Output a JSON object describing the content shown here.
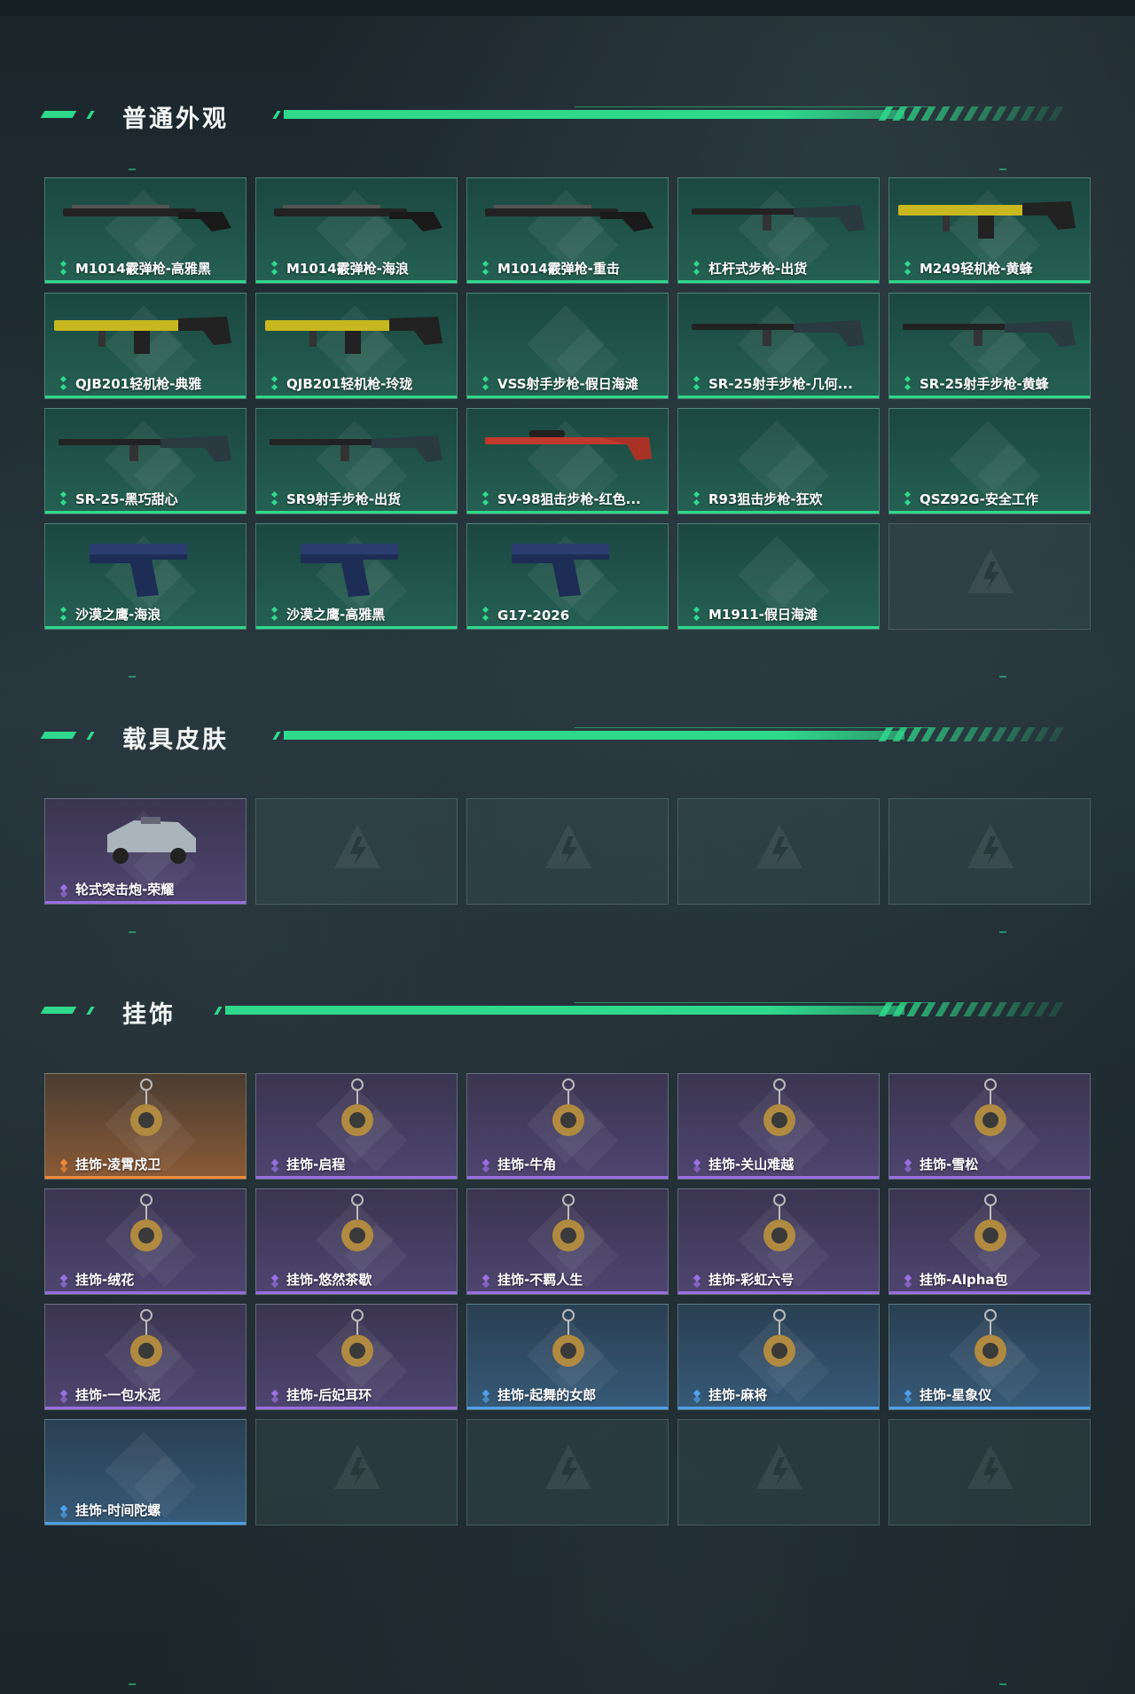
{
  "sections": [
    {
      "title": "普通外观",
      "items": [
        {
          "label": "M1014霰弹枪-高雅黑",
          "rarity": "green",
          "icon": "shotgun-icon"
        },
        {
          "label": "M1014霰弹枪-海浪",
          "rarity": "green",
          "icon": "shotgun-icon"
        },
        {
          "label": "M1014霰弹枪-重击",
          "rarity": "green",
          "icon": "shotgun-icon"
        },
        {
          "label": "杠杆式步枪-出货",
          "rarity": "green",
          "icon": "rifle-icon"
        },
        {
          "label": "M249轻机枪-黄蜂",
          "rarity": "green",
          "icon": "machine-gun-icon"
        },
        {
          "label": "QJB201轻机枪-典雅",
          "rarity": "green",
          "icon": "machine-gun-icon"
        },
        {
          "label": "QJB201轻机枪-玲珑",
          "rarity": "green",
          "icon": "machine-gun-icon"
        },
        {
          "label": "VSS射手步枪-假日海滩",
          "rarity": "green",
          "icon": ""
        },
        {
          "label": "SR-25射手步枪-几何...",
          "rarity": "green",
          "icon": "rifle-icon"
        },
        {
          "label": "SR-25射手步枪-黄蜂",
          "rarity": "green",
          "icon": "rifle-icon"
        },
        {
          "label": "SR-25-黑巧甜心",
          "rarity": "green",
          "icon": "rifle-icon"
        },
        {
          "label": "SR9射手步枪-出货",
          "rarity": "green",
          "icon": "rifle-icon"
        },
        {
          "label": "SV-98狙击步枪-红色...",
          "rarity": "green",
          "icon": "sniper-icon"
        },
        {
          "label": "R93狙击步枪-狂欢",
          "rarity": "green",
          "icon": ""
        },
        {
          "label": "QSZ92G-安全工作",
          "rarity": "green",
          "icon": ""
        },
        {
          "label": "沙漠之鹰-海浪",
          "rarity": "green",
          "icon": "pistol-icon"
        },
        {
          "label": "沙漠之鹰-高雅黑",
          "rarity": "green",
          "icon": "pistol-icon"
        },
        {
          "label": "G17-2026",
          "rarity": "green",
          "icon": "pistol-icon"
        },
        {
          "label": "M1911-假日海滩",
          "rarity": "green",
          "icon": ""
        },
        {
          "label": "",
          "rarity": "empty",
          "icon": "logo-icon"
        }
      ]
    },
    {
      "title": "载具皮肤",
      "items": [
        {
          "label": "轮式突击炮-荣耀",
          "rarity": "purple",
          "icon": "vehicle-icon"
        },
        {
          "label": "",
          "rarity": "empty",
          "icon": "logo-icon"
        },
        {
          "label": "",
          "rarity": "empty",
          "icon": "logo-icon"
        },
        {
          "label": "",
          "rarity": "empty",
          "icon": "logo-icon"
        },
        {
          "label": "",
          "rarity": "empty",
          "icon": "logo-icon"
        }
      ]
    },
    {
      "title": "挂饰",
      "items": [
        {
          "label": "挂饰-凌霄戍卫",
          "rarity": "orange",
          "icon": "charm-icon"
        },
        {
          "label": "挂饰-启程",
          "rarity": "purple",
          "icon": "charm-icon"
        },
        {
          "label": "挂饰-牛角",
          "rarity": "purple",
          "icon": "charm-icon"
        },
        {
          "label": "挂饰-关山难越",
          "rarity": "purple",
          "icon": "charm-icon"
        },
        {
          "label": "挂饰-雪松",
          "rarity": "purple",
          "icon": "charm-icon"
        },
        {
          "label": "挂饰-绒花",
          "rarity": "purple",
          "icon": "charm-icon"
        },
        {
          "label": "挂饰-悠然茶歇",
          "rarity": "purple",
          "icon": "charm-icon"
        },
        {
          "label": "挂饰-不羁人生",
          "rarity": "purple",
          "icon": "charm-icon"
        },
        {
          "label": "挂饰-彩虹六号",
          "rarity": "purple",
          "icon": "charm-icon"
        },
        {
          "label": "挂饰-Alpha包",
          "rarity": "purple",
          "icon": "charm-icon"
        },
        {
          "label": "挂饰-一包水泥",
          "rarity": "purple",
          "icon": "charm-icon"
        },
        {
          "label": "挂饰-后妃耳环",
          "rarity": "purple",
          "icon": "charm-icon"
        },
        {
          "label": "挂饰-起舞的女郎",
          "rarity": "blue",
          "icon": "charm-icon"
        },
        {
          "label": "挂饰-麻将",
          "rarity": "blue",
          "icon": "charm-icon"
        },
        {
          "label": "挂饰-星象仪",
          "rarity": "blue",
          "icon": "charm-icon"
        },
        {
          "label": "挂饰-时间陀螺",
          "rarity": "blue",
          "icon": ""
        },
        {
          "label": "",
          "rarity": "empty",
          "icon": "logo-icon"
        },
        {
          "label": "",
          "rarity": "empty",
          "icon": "logo-icon"
        },
        {
          "label": "",
          "rarity": "empty",
          "icon": "logo-icon"
        },
        {
          "label": "",
          "rarity": "empty",
          "icon": "logo-icon"
        }
      ]
    }
  ],
  "colors": {
    "accent": "#2fd98c",
    "rarity_green": "#2fd98c",
    "rarity_purple": "#9a6fe0",
    "rarity_orange": "#f08a3a",
    "rarity_blue": "#4fa0e8"
  }
}
